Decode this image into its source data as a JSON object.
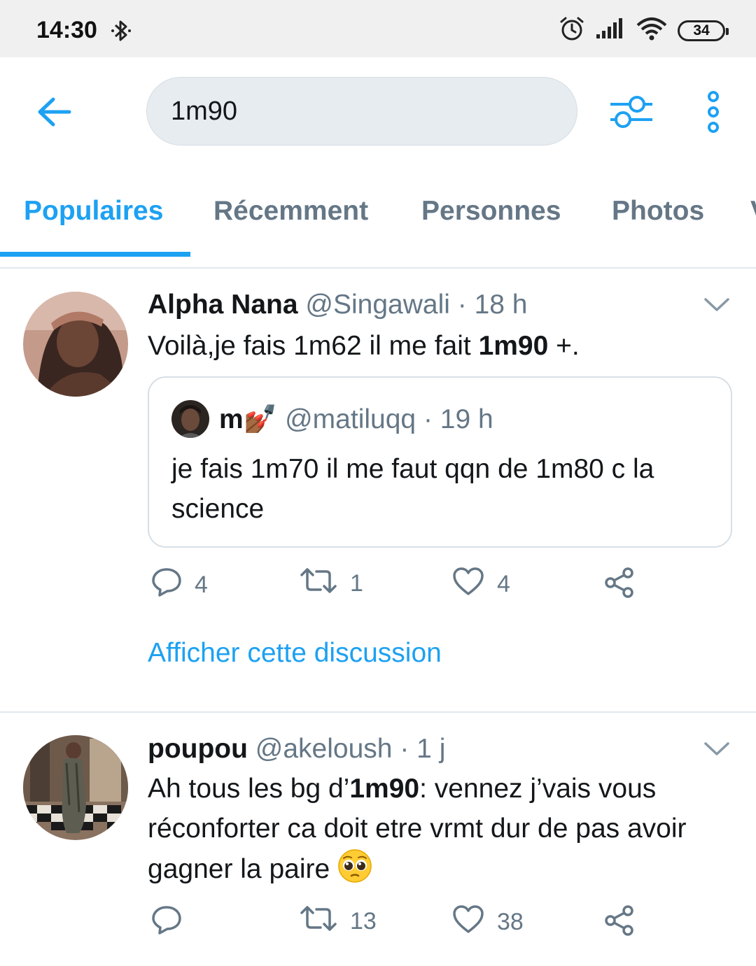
{
  "status_bar": {
    "time": "14:30",
    "battery": "34"
  },
  "search": {
    "value": "1m90"
  },
  "tabs": [
    {
      "label": "Populaires"
    },
    {
      "label": "Récemment"
    },
    {
      "label": "Personnes"
    },
    {
      "label": "Photos"
    },
    {
      "label": "V"
    }
  ],
  "colors": {
    "accent": "#1da1f2",
    "secondary_text": "#657786",
    "divider": "#e1e8ed"
  },
  "tweets": [
    {
      "name": "Alpha Nana",
      "handle": "@Singawali",
      "sep": " · ",
      "time": "18 h",
      "text_before": "Voilà,je fais 1m62 il me fait ",
      "text_bold": "1m90",
      "text_after": " +.",
      "quote": {
        "name": "m",
        "name_emoji": "💅🏾",
        "handle": "@matiluqq",
        "sep": " · ",
        "time": "19 h",
        "text": "je fais 1m70 il me faut qqn de 1m80 c la science"
      },
      "replies": "4",
      "retweets": "1",
      "likes": "4",
      "show_thread": "Afficher cette discussion"
    },
    {
      "name": "poupou",
      "handle": "@akeloush",
      "sep": " · ",
      "time": "1 j",
      "text_before": "Ah tous les bg d’",
      "text_bold": "1m90",
      "text_after": ": vennez j’vais vous réconforter ca doit etre vrmt dur de pas avoir gagner la paire ",
      "emoji": "🥺",
      "replies": "",
      "retweets": "13",
      "likes": "38"
    }
  ]
}
